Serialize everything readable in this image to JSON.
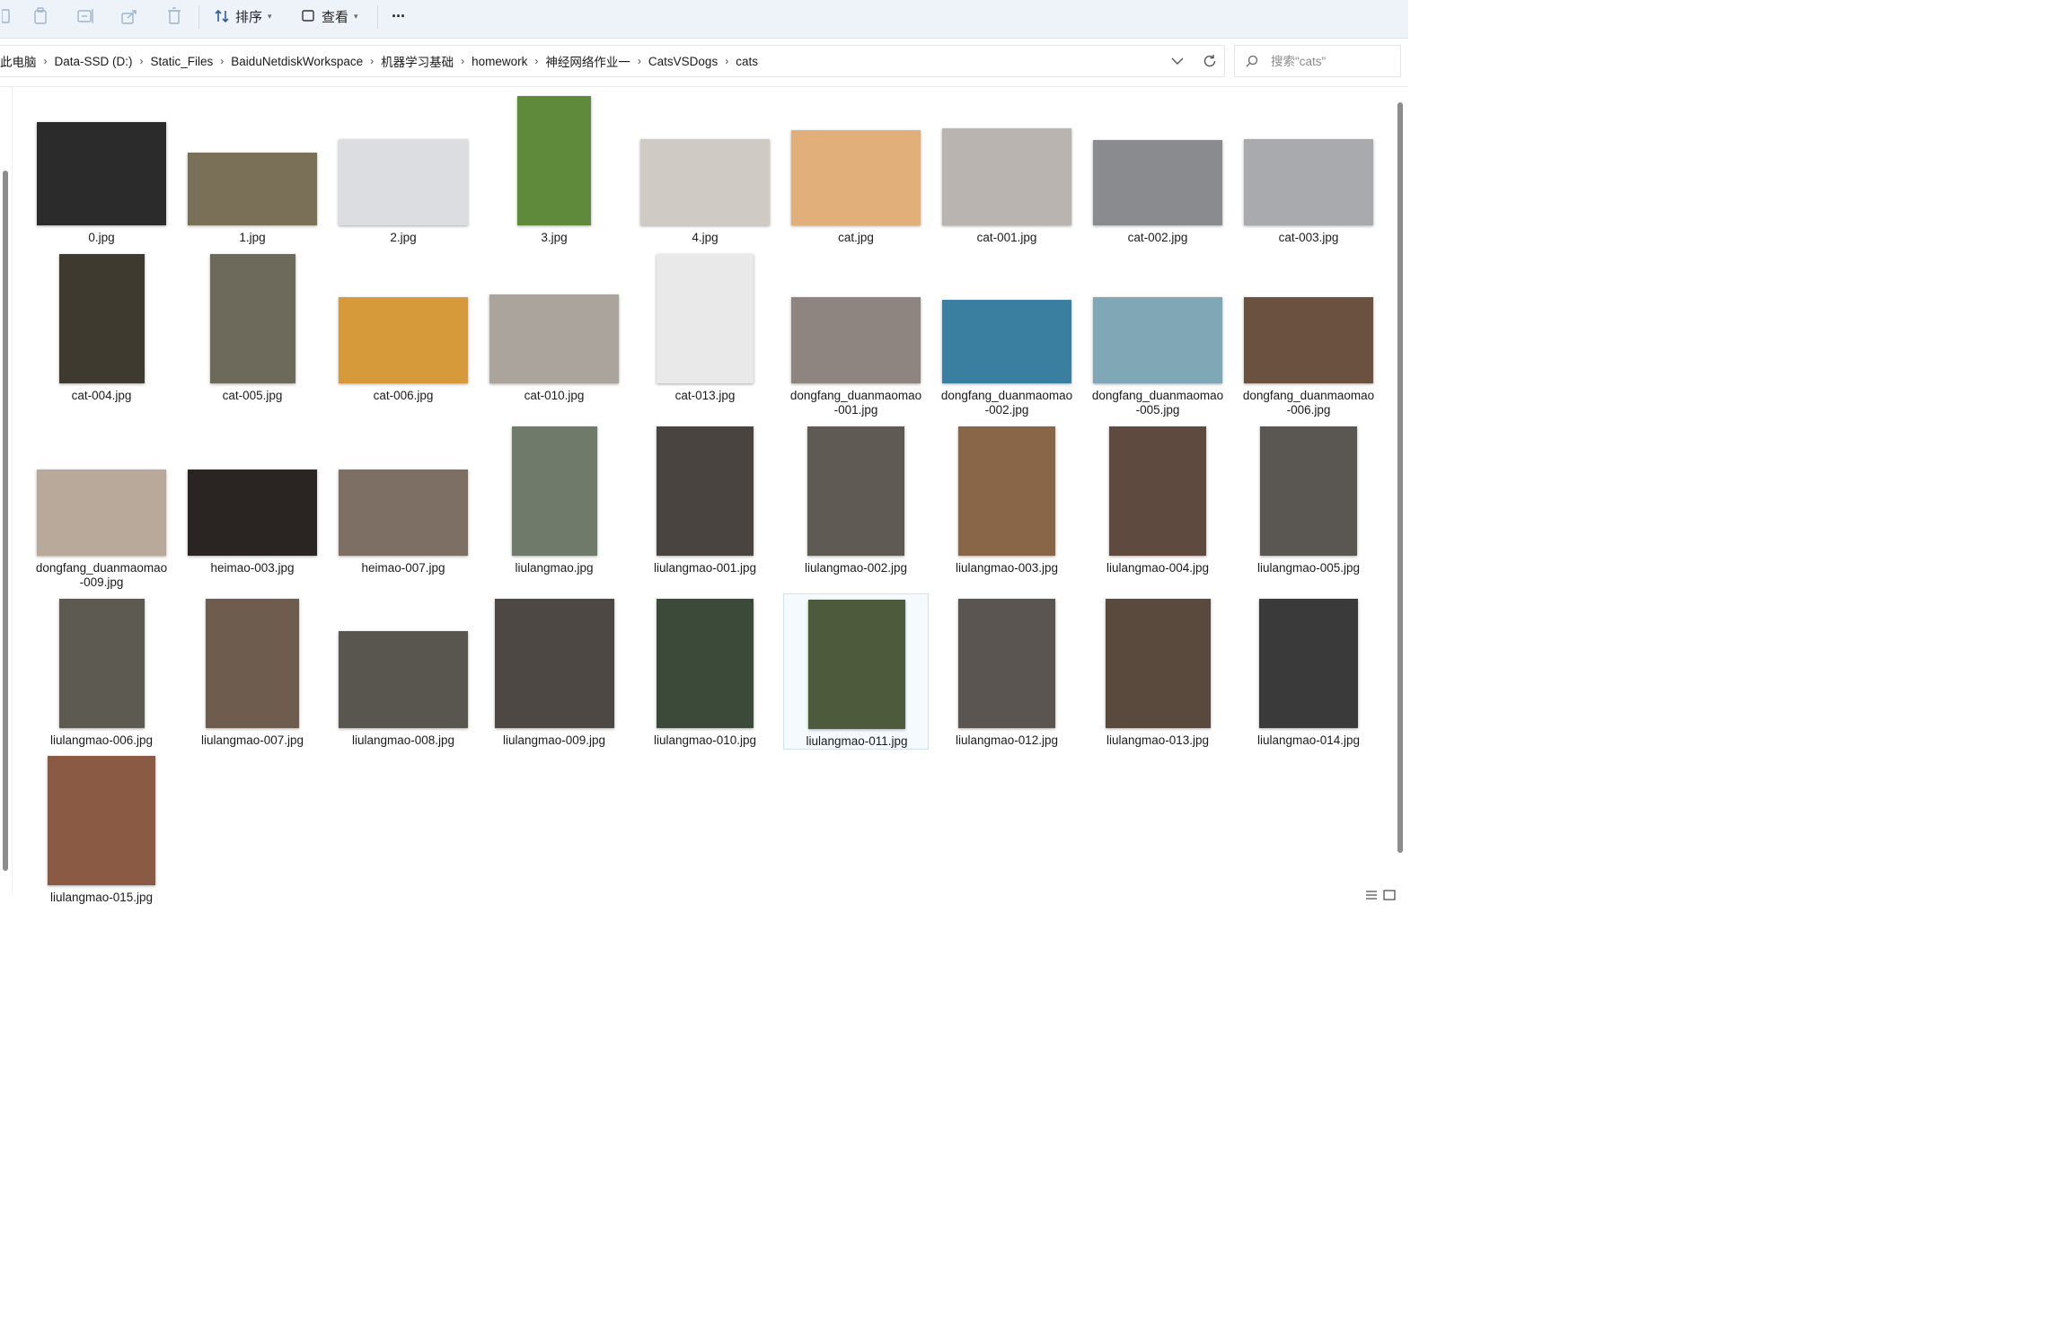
{
  "toolbar": {
    "sort_label": "排序",
    "view_label": "查看",
    "more_label": "···"
  },
  "address": {
    "crumbs": [
      "此电脑",
      "Data-SSD (D:)",
      "Static_Files",
      "BaiduNetdiskWorkspace",
      "机器学习基础",
      "homework",
      "神经网络作业一",
      "CatsVSDogs",
      "cats"
    ]
  },
  "search": {
    "placeholder": "搜索\"cats\""
  },
  "files": [
    {
      "name": "0.jpg",
      "color": "#2b2b2b"
    },
    {
      "name": "1.jpg",
      "color": "#7a7058"
    },
    {
      "name": "2.jpg",
      "color": "#dcdde0"
    },
    {
      "name": "3.jpg",
      "color": "#5f8a3c"
    },
    {
      "name": "4.jpg",
      "color": "#cfcac4"
    },
    {
      "name": "cat.jpg",
      "color": "#e1b07a"
    },
    {
      "name": "cat-001.jpg",
      "color": "#b9b4b0"
    },
    {
      "name": "cat-002.jpg",
      "color": "#8a8b8f"
    },
    {
      "name": "cat-003.jpg",
      "color": "#a9aaae"
    },
    {
      "name": "cat-004.jpg",
      "color": "#3f3a30"
    },
    {
      "name": "cat-005.jpg",
      "color": "#6d6a5c"
    },
    {
      "name": "cat-006.jpg",
      "color": "#d69a3a"
    },
    {
      "name": "cat-010.jpg",
      "color": "#aaa49c"
    },
    {
      "name": "cat-013.jpg",
      "color": "#e9e9e9"
    },
    {
      "name": "dongfang_duanmaomao-001.jpg",
      "color": "#8f8580"
    },
    {
      "name": "dongfang_duanmaomao-002.jpg",
      "color": "#3b7fa0"
    },
    {
      "name": "dongfang_duanmaomao-005.jpg",
      "color": "#7fa7b5"
    },
    {
      "name": "dongfang_duanmaomao-006.jpg",
      "color": "#6b5240"
    },
    {
      "name": "dongfang_duanmaomao-009.jpg",
      "color": "#b9a99a"
    },
    {
      "name": "heimao-003.jpg",
      "color": "#2a2522"
    },
    {
      "name": "heimao-007.jpg",
      "color": "#7d6f64"
    },
    {
      "name": "liulangmao.jpg",
      "color": "#6f7a6a"
    },
    {
      "name": "liulangmao-001.jpg",
      "color": "#4a4440"
    },
    {
      "name": "liulangmao-002.jpg",
      "color": "#5f5a54"
    },
    {
      "name": "liulangmao-003.jpg",
      "color": "#8a6648"
    },
    {
      "name": "liulangmao-004.jpg",
      "color": "#5e4a3e"
    },
    {
      "name": "liulangmao-005.jpg",
      "color": "#5a5652"
    },
    {
      "name": "liulangmao-006.jpg",
      "color": "#5d5a52"
    },
    {
      "name": "liulangmao-007.jpg",
      "color": "#6e5c4e"
    },
    {
      "name": "liulangmao-008.jpg",
      "color": "#59554f"
    },
    {
      "name": "liulangmao-009.jpg",
      "color": "#4e4844"
    },
    {
      "name": "liulangmao-010.jpg",
      "color": "#3c4a3a"
    },
    {
      "name": "liulangmao-011.jpg",
      "color": "#4e5a3c"
    },
    {
      "name": "liulangmao-012.jpg",
      "color": "#5a5551"
    },
    {
      "name": "liulangmao-013.jpg",
      "color": "#5a4a3e"
    },
    {
      "name": "liulangmao-014.jpg",
      "color": "#3a3a3a"
    },
    {
      "name": "liulangmao-015.jpg",
      "color": "#8a5a45"
    }
  ],
  "selected_file": "liulangmao-011.jpg"
}
